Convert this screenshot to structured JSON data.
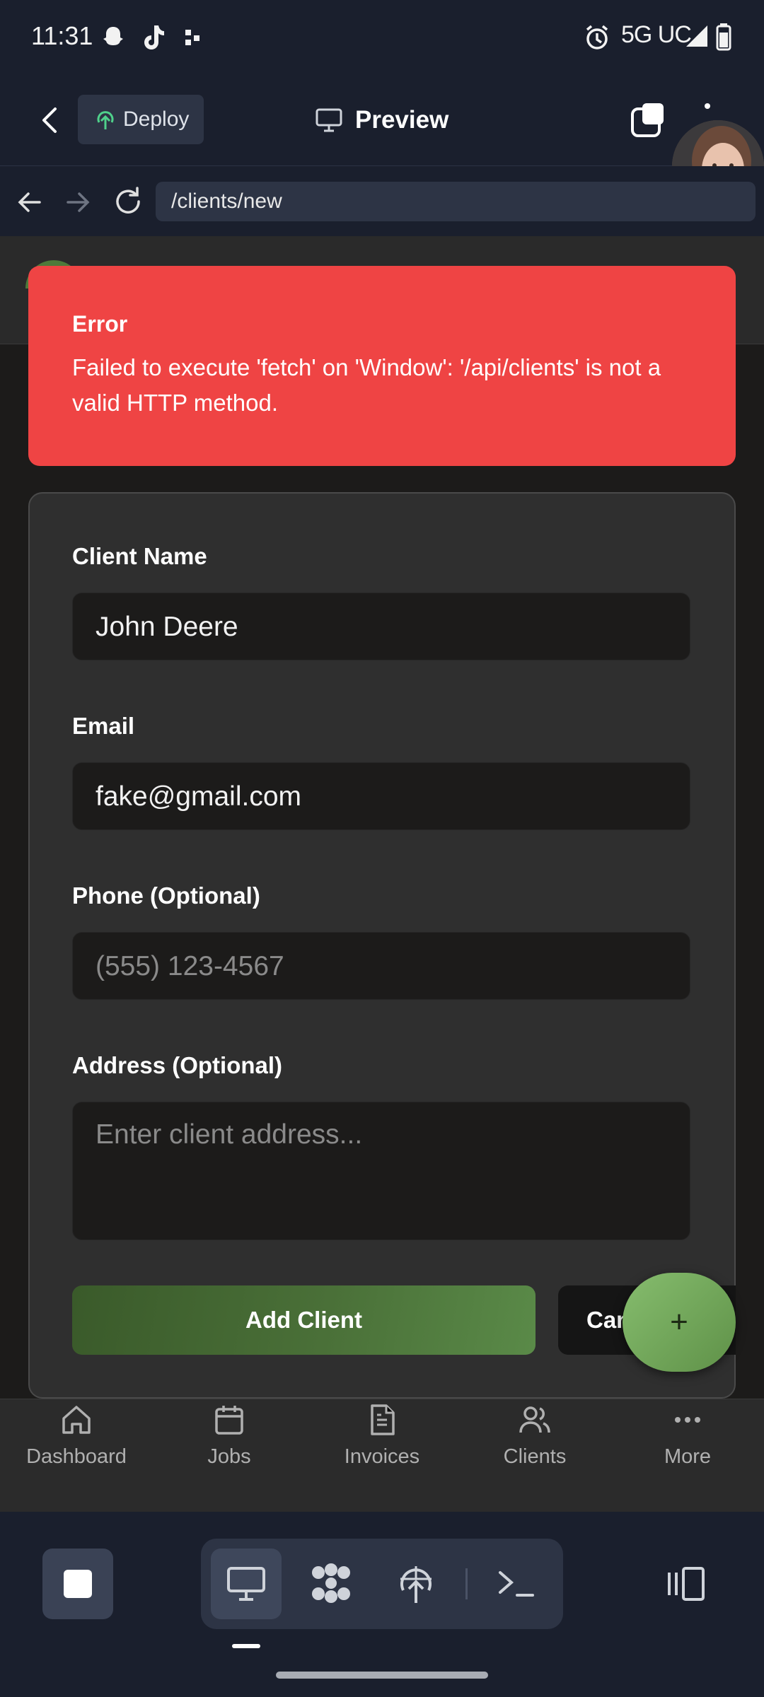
{
  "status_bar": {
    "time": "11:31",
    "network": "5G UC",
    "left_icons": [
      "snapchat-icon",
      "tiktok-icon",
      "app-dots-icon"
    ],
    "right_icons": [
      "alarm-icon",
      "signal-icon",
      "battery-icon"
    ]
  },
  "header": {
    "deploy_label": "Deploy",
    "title": "Preview"
  },
  "browser": {
    "url": "/clients/new"
  },
  "error": {
    "title": "Error",
    "message": "Failed to execute 'fetch' on 'Window': '/api/clients' is not a valid HTTP method."
  },
  "form": {
    "client_name": {
      "label": "Client Name",
      "value": "John Deere"
    },
    "email": {
      "label": "Email",
      "value": "fake@gmail.com"
    },
    "phone": {
      "label": "Phone (Optional)",
      "placeholder": "(555) 123-4567"
    },
    "address": {
      "label": "Address (Optional)",
      "placeholder": "Enter client address..."
    },
    "submit_label": "Add Client",
    "cancel_label": "Can"
  },
  "fab": {
    "label": "+"
  },
  "bottom_nav": [
    {
      "label": "Dashboard",
      "icon": "home-icon"
    },
    {
      "label": "Jobs",
      "icon": "calendar-icon"
    },
    {
      "label": "Invoices",
      "icon": "document-icon"
    },
    {
      "label": "Clients",
      "icon": "users-icon"
    },
    {
      "label": "More",
      "icon": "more-dots-icon"
    }
  ],
  "toolbar": {
    "icons": [
      "stop-icon",
      "monitor-icon",
      "agent-icon",
      "deploy-icon",
      "terminal-icon",
      "split-view-icon"
    ]
  },
  "colors": {
    "background": "#1a1f2d",
    "error": "#ef4444",
    "accent_green": "#4a7038",
    "card": "#2f2f2f"
  }
}
